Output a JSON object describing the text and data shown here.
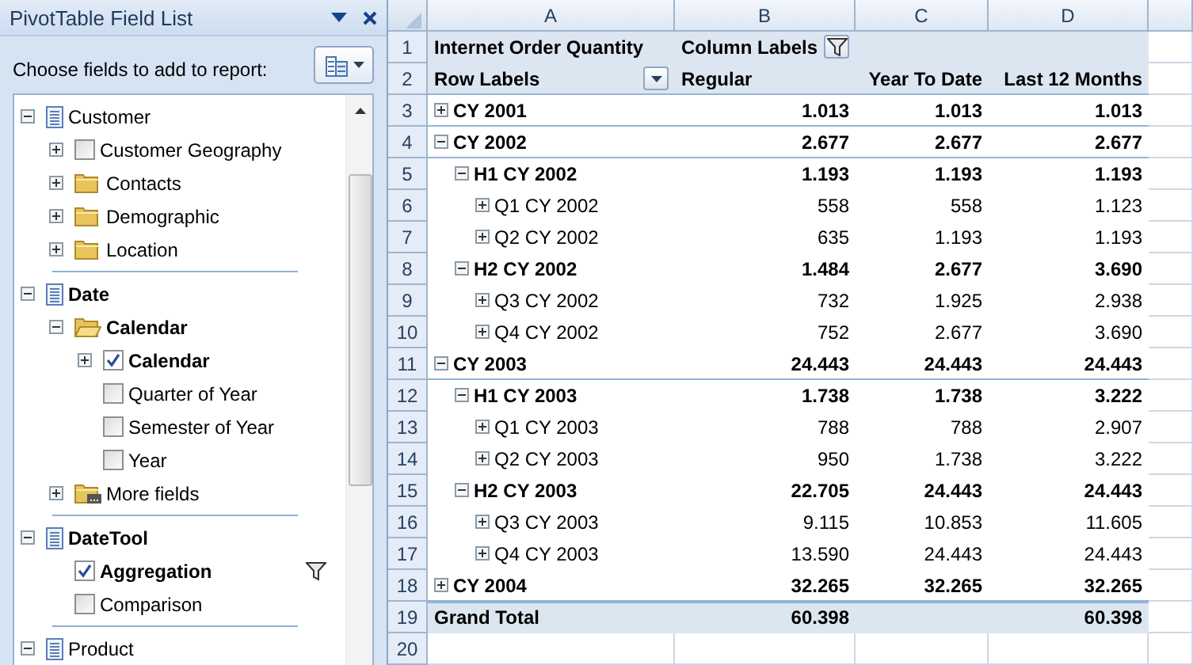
{
  "panel": {
    "title": "PivotTable Field List",
    "instruction": "Choose fields to add to report:",
    "fields": [
      {
        "kind": "table",
        "label": "Customer",
        "active": false,
        "expanded": true,
        "children": [
          {
            "kind": "field",
            "label": "Customer Geography",
            "active": false,
            "checked": false,
            "expanded": false
          },
          {
            "kind": "folder",
            "label": "Contacts",
            "active": false,
            "expanded": false
          },
          {
            "kind": "folder",
            "label": "Demographic",
            "active": false,
            "expanded": false
          },
          {
            "kind": "folder",
            "label": "Location",
            "active": false,
            "expanded": false
          }
        ]
      },
      {
        "kind": "table",
        "label": "Date",
        "active": true,
        "expanded": true,
        "children": [
          {
            "kind": "folder",
            "label": "Calendar",
            "active": true,
            "expanded": true,
            "children": [
              {
                "kind": "field",
                "label": "Calendar",
                "active": true,
                "checked": true,
                "expanded": false
              },
              {
                "kind": "field",
                "label": "Quarter of Year",
                "active": false,
                "checked": false
              },
              {
                "kind": "field",
                "label": "Semester of Year",
                "active": false,
                "checked": false
              },
              {
                "kind": "field",
                "label": "Year",
                "active": false,
                "checked": false
              }
            ]
          },
          {
            "kind": "more",
            "label": "More fields",
            "active": false,
            "expanded": false
          }
        ]
      },
      {
        "kind": "table",
        "label": "DateTool",
        "active": true,
        "expanded": true,
        "children": [
          {
            "kind": "field",
            "label": "Aggregation",
            "active": true,
            "checked": true,
            "filtered": true
          },
          {
            "kind": "field",
            "label": "Comparison",
            "active": false,
            "checked": false
          }
        ]
      },
      {
        "kind": "table",
        "label": "Product",
        "active": false,
        "expanded": true
      }
    ]
  },
  "sheet": {
    "columns": [
      "A",
      "B",
      "C",
      "D"
    ],
    "title_row": {
      "row": "1",
      "measure": "Internet Order Quantity",
      "column_labels": "Column Labels"
    },
    "header_row": {
      "row": "2",
      "row_labels": "Row Labels",
      "columns": [
        "Regular",
        "Year To Date",
        "Last 12 Months"
      ]
    },
    "rows": [
      {
        "row": "3",
        "label": "CY 2001",
        "expanded": false,
        "values": [
          "1.013",
          "1.013",
          "1.013"
        ]
      },
      {
        "row": "4",
        "label": "CY 2002",
        "expanded": true,
        "values": [
          "2.677",
          "2.677",
          "2.677"
        ],
        "children": [
          {
            "row": "5",
            "label": "H1 CY 2002",
            "expanded": true,
            "values": [
              "1.193",
              "1.193",
              "1.193"
            ],
            "children": [
              {
                "row": "6",
                "label": "Q1 CY 2002",
                "expanded": false,
                "values": [
                  "558",
                  "558",
                  "1.123"
                ]
              },
              {
                "row": "7",
                "label": "Q2 CY 2002",
                "expanded": false,
                "values": [
                  "635",
                  "1.193",
                  "1.193"
                ]
              }
            ]
          },
          {
            "row": "8",
            "label": "H2 CY 2002",
            "expanded": true,
            "values": [
              "1.484",
              "2.677",
              "3.690"
            ],
            "children": [
              {
                "row": "9",
                "label": "Q3 CY 2002",
                "expanded": false,
                "values": [
                  "732",
                  "1.925",
                  "2.938"
                ]
              },
              {
                "row": "10",
                "label": "Q4 CY 2002",
                "expanded": false,
                "values": [
                  "752",
                  "2.677",
                  "3.690"
                ]
              }
            ]
          }
        ]
      },
      {
        "row": "11",
        "label": "CY 2003",
        "expanded": true,
        "values": [
          "24.443",
          "24.443",
          "24.443"
        ],
        "children": [
          {
            "row": "12",
            "label": "H1 CY 2003",
            "expanded": true,
            "values": [
              "1.738",
              "1.738",
              "3.222"
            ],
            "children": [
              {
                "row": "13",
                "label": "Q1 CY 2003",
                "expanded": false,
                "values": [
                  "788",
                  "788",
                  "2.907"
                ]
              },
              {
                "row": "14",
                "label": "Q2 CY 2003",
                "expanded": false,
                "values": [
                  "950",
                  "1.738",
                  "3.222"
                ]
              }
            ]
          },
          {
            "row": "15",
            "label": "H2 CY 2003",
            "expanded": true,
            "values": [
              "22.705",
              "24.443",
              "24.443"
            ],
            "children": [
              {
                "row": "16",
                "label": "Q3 CY 2003",
                "expanded": false,
                "values": [
                  "9.115",
                  "10.853",
                  "11.605"
                ]
              },
              {
                "row": "17",
                "label": "Q4 CY 2003",
                "expanded": false,
                "values": [
                  "13.590",
                  "24.443",
                  "24.443"
                ]
              }
            ]
          }
        ]
      },
      {
        "row": "18",
        "label": "CY 2004",
        "expanded": false,
        "values": [
          "32.265",
          "32.265",
          "32.265"
        ]
      }
    ],
    "grand_total": {
      "row": "19",
      "label": "Grand Total",
      "regular": "60.398",
      "last_12_months": "60.398"
    },
    "empty_rows": [
      "20"
    ]
  }
}
